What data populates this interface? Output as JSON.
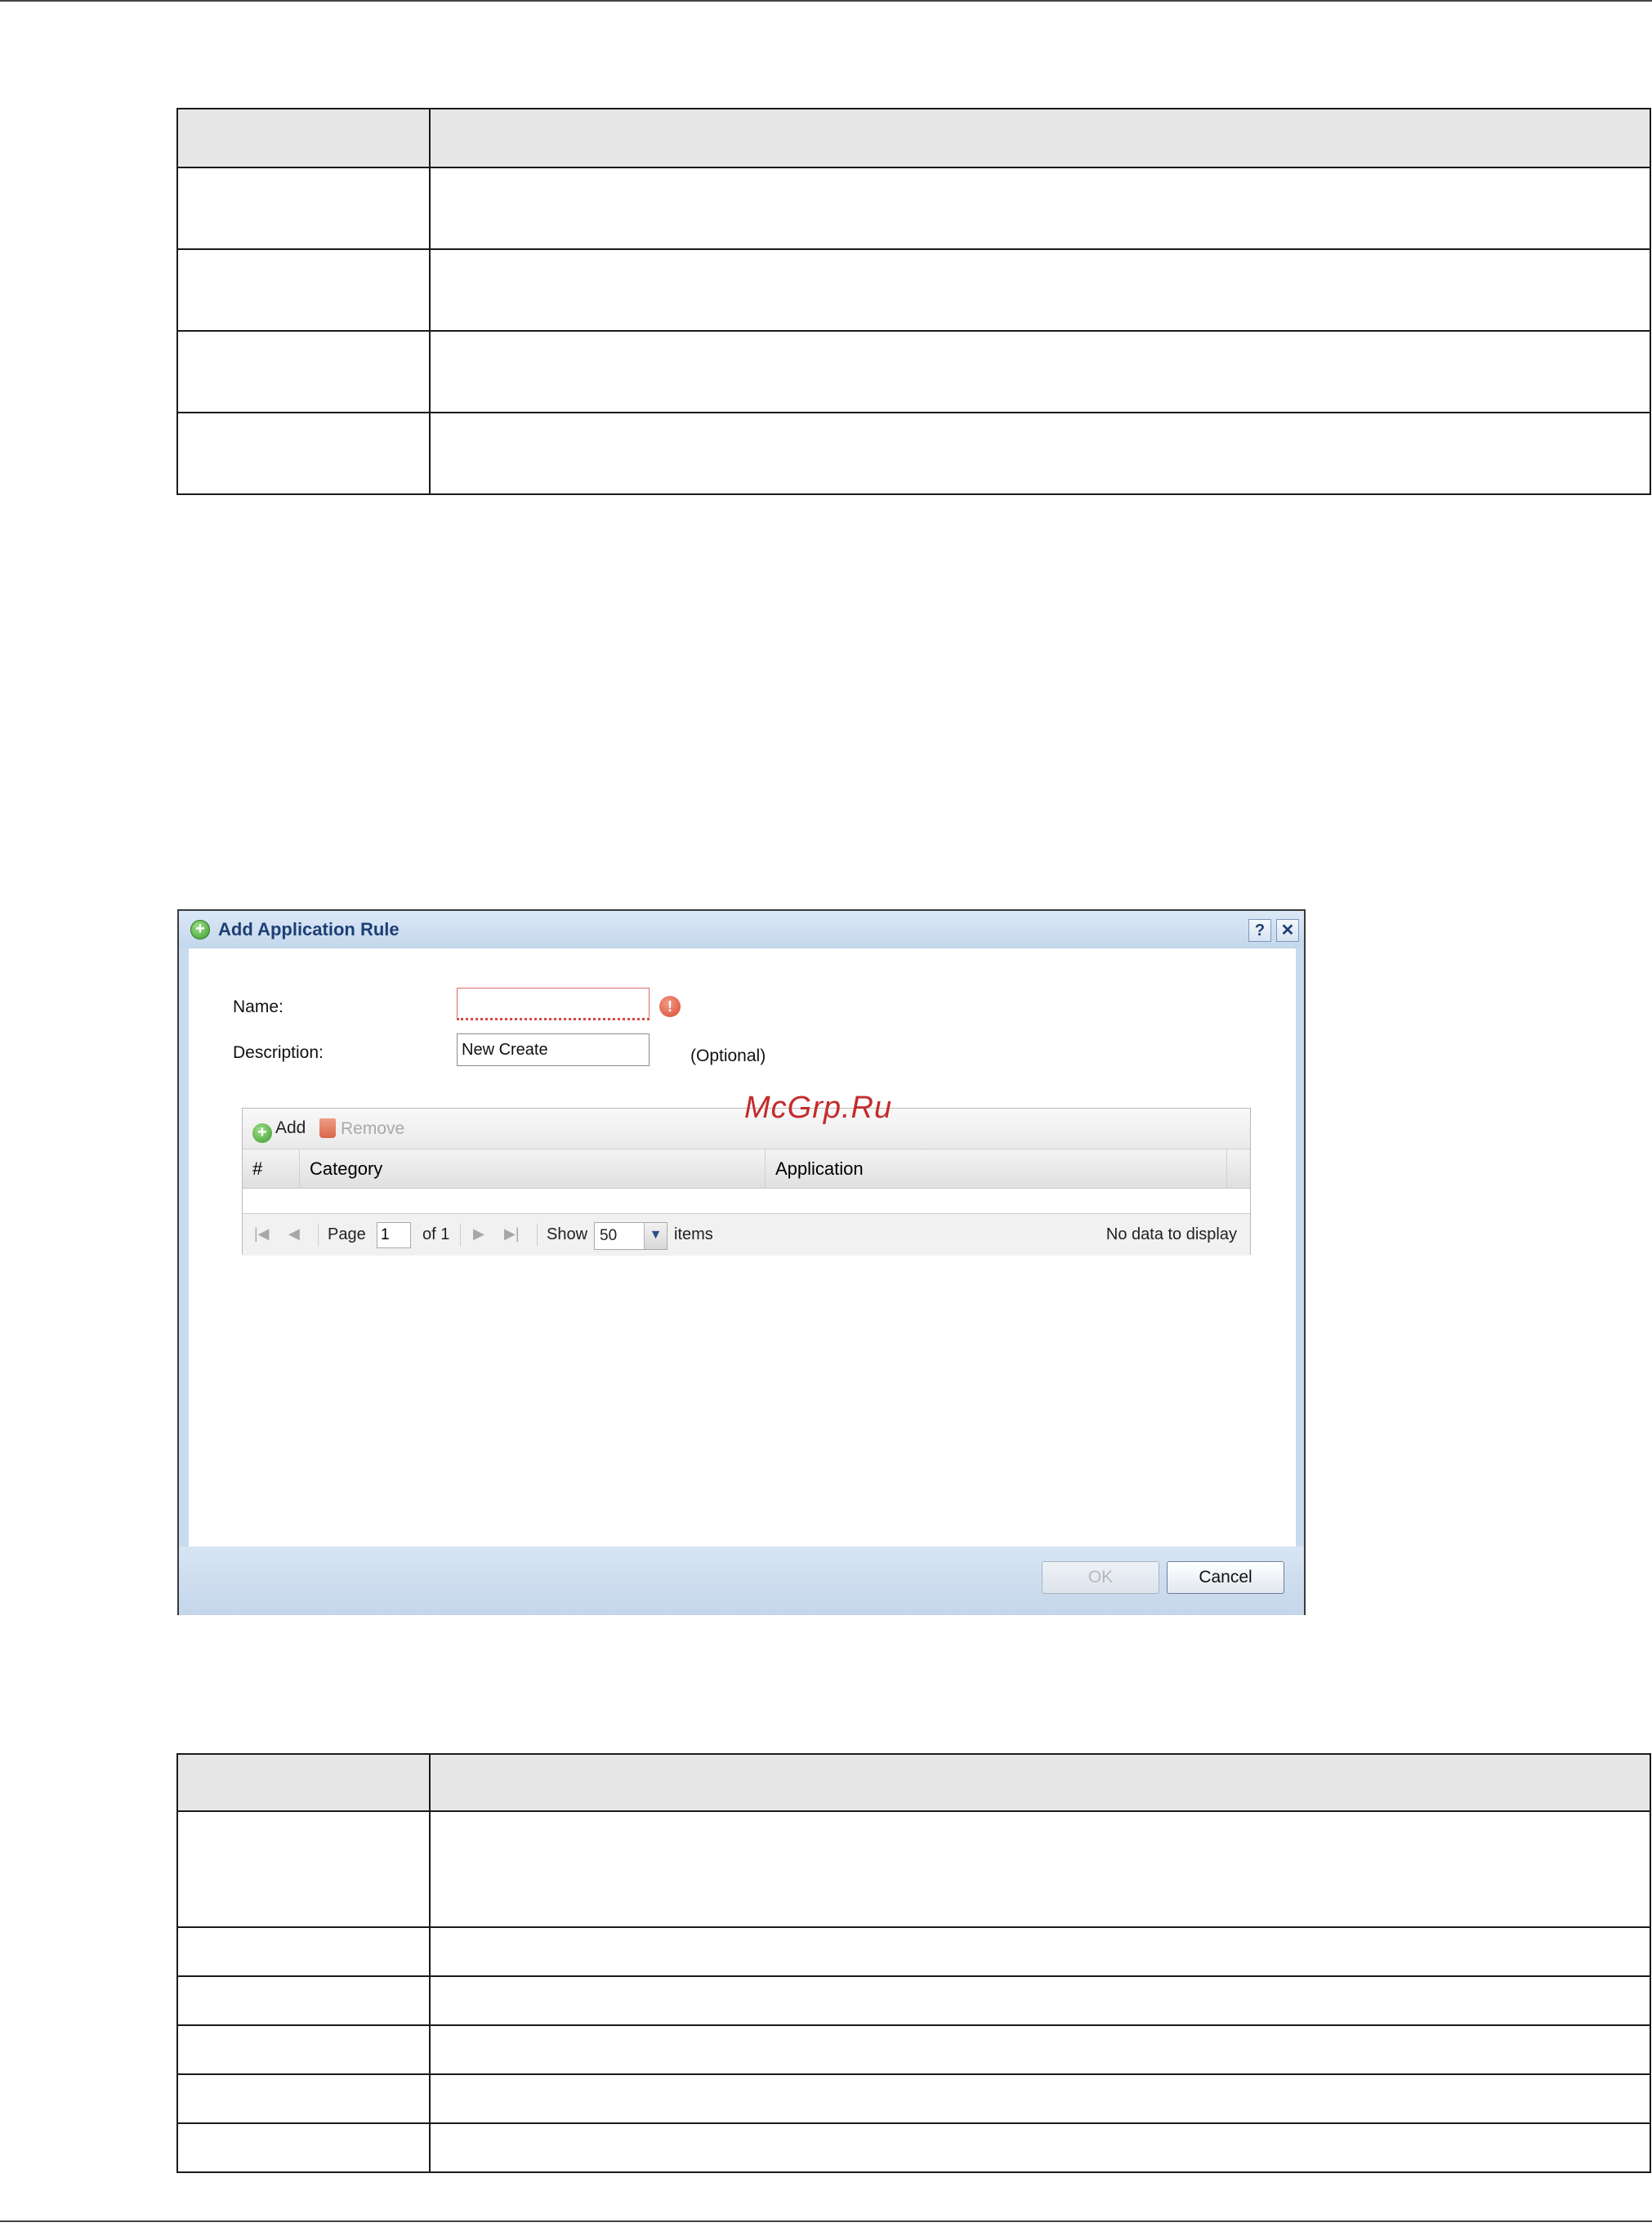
{
  "dialog": {
    "title": "Add Application Rule",
    "help_symbol": "?",
    "close_symbol": "✕",
    "name_label": "Name:",
    "name_value": "",
    "description_label": "Description:",
    "description_value": "New Create",
    "optional_note": "(Optional)",
    "toolbar": {
      "add_label": "Add",
      "remove_label": "Remove"
    },
    "columns": {
      "number": "#",
      "category": "Category",
      "application": "Application"
    },
    "pager": {
      "page_label": "Page",
      "page_value": "1",
      "of_label": "of 1",
      "show_label": "Show",
      "show_value": "50",
      "items_label": "items",
      "status": "No data to display"
    },
    "ok_label": "OK",
    "cancel_label": "Cancel"
  },
  "watermark": "McGrp.Ru",
  "icons": {
    "add": "add-circle-icon",
    "remove": "trash-icon",
    "error": "error-icon",
    "help": "help-icon",
    "close": "close-icon"
  },
  "colors": {
    "dialog_frame": "#c9dbee",
    "title_text": "#1e3f75",
    "error": "#d94b2f",
    "watermark": "#c42b2b"
  }
}
